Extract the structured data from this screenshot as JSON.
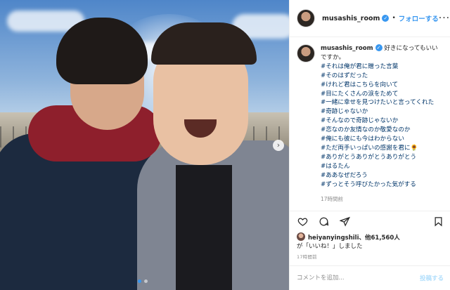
{
  "post": {
    "username": "musashis_room",
    "follow_label": "フォローする",
    "separator": "•",
    "more_icon": "more-options-icon",
    "caption_intro": "好きになってもいいですか。",
    "hashtags": [
      "#それは俺が君に贈った言葉",
      "#そのはずだった",
      "#けれど君はこちらを向いて",
      "#目にたくさんの涙をためて",
      "#一緒に幸せを見つけたいと言ってくれた",
      "#奇跡じゃないか",
      "#そんなので奇跡じゃないか",
      "#恋なのか友情なのか敬愛なのか",
      "#俺にも彼にも今はわからない",
      "#ただ両手いっぱいの感謝を君に🌻",
      "#ありがとうありがとうありがとう",
      "#はるたん",
      "#ああなぜだろう",
      "#ずっとそう呼びたかった気がする"
    ],
    "relative_time": "17時間前",
    "likes": {
      "liker": "heiyanyingshili",
      "others": "、他61,560人",
      "suffix": "が「いいね！」しました"
    },
    "date": "17時間前",
    "comment_placeholder": "コメントを追加...",
    "post_label": "投稿する"
  },
  "icons": {
    "like": "heart-icon",
    "comment": "comment-icon",
    "share": "share-icon",
    "save": "bookmark-icon",
    "verified": "verified-badge-icon",
    "next": "chevron-right-icon"
  },
  "colors": {
    "accent": "#3897f0",
    "hashtag": "#003569",
    "muted": "#8e8e8e"
  },
  "carousel": {
    "current": 1,
    "total": 2
  }
}
